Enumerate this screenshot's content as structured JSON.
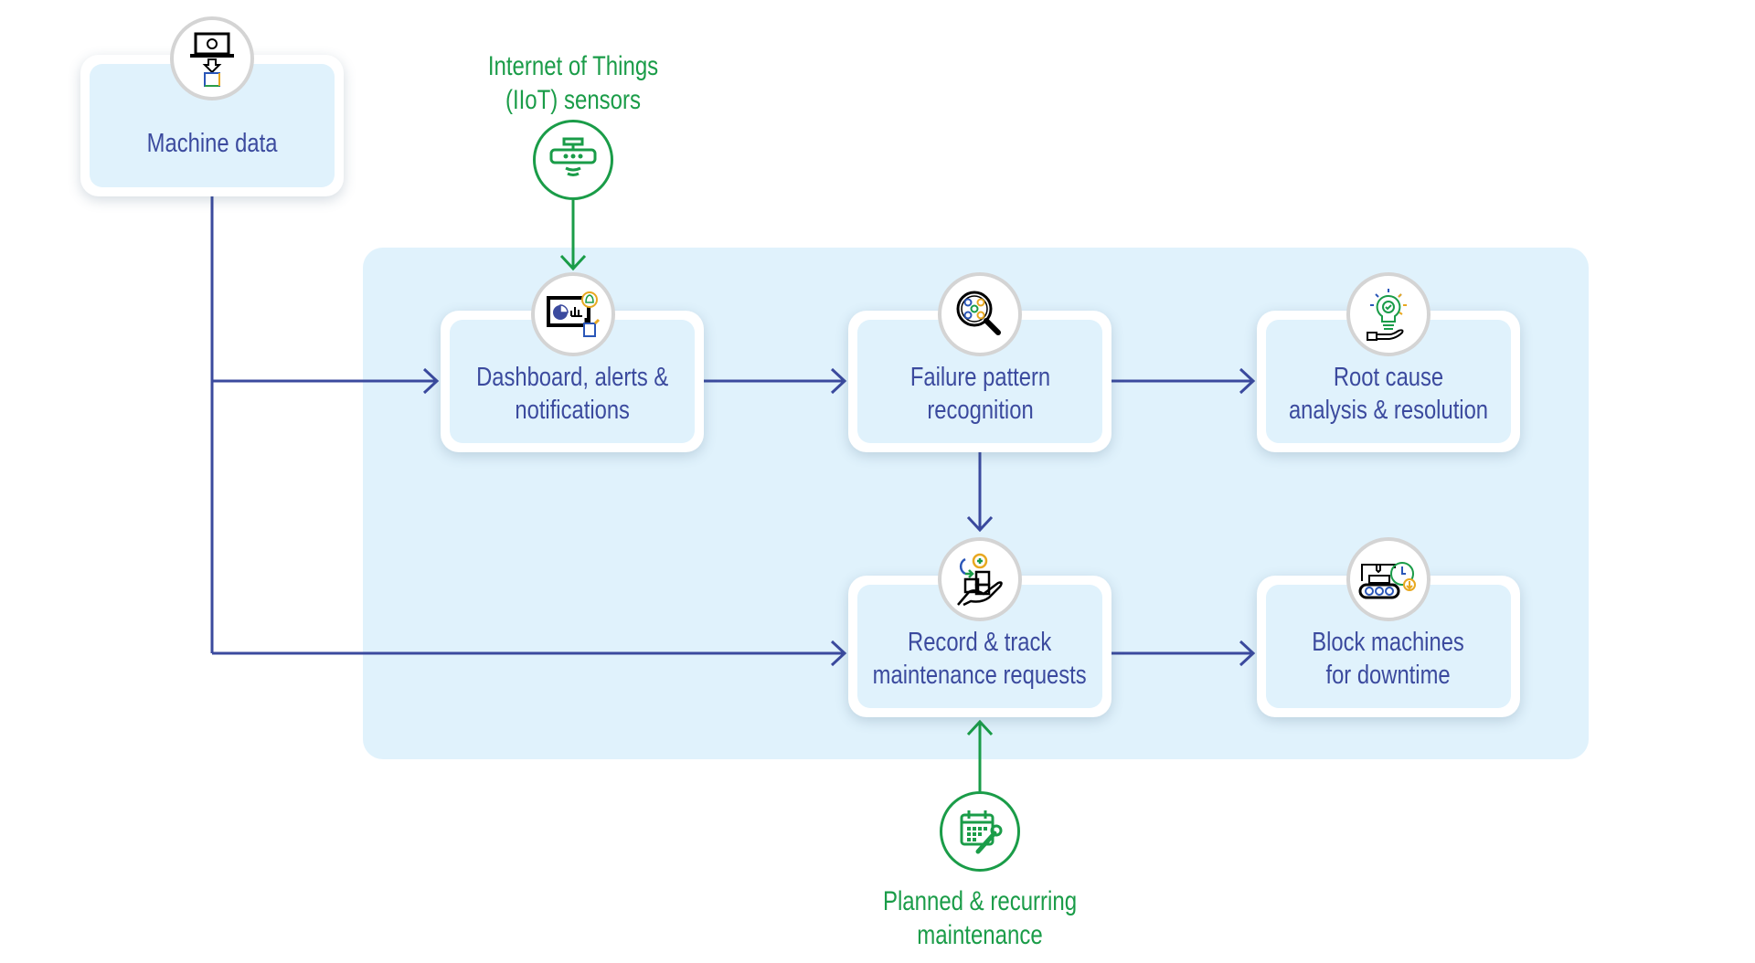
{
  "diagram": {
    "colors": {
      "flow_blue": "#3b4a9e",
      "external_green": "#1a9c48",
      "panel_bg": "#e0f2fc",
      "card_bg": "#ffffff",
      "icon_ring": "#d4d4d4"
    },
    "sources": {
      "machine_data": {
        "label": "Machine data",
        "icon": "laptop-to-spreadsheet-icon"
      },
      "iiot_sensors": {
        "label_line1": "Internet of Things",
        "label_line2": "(IIoT) sensors",
        "icon": "sensor-icon"
      },
      "planned_maintenance": {
        "label_line1": "Planned & recurring",
        "label_line2": "maintenance",
        "icon": "calendar-wrench-icon"
      }
    },
    "steps": [
      {
        "id": "dashboard",
        "label_line1": "Dashboard, alerts &",
        "label_line2": "notifications",
        "icon": "dashboard-alert-icon"
      },
      {
        "id": "failure_pattern",
        "label_line1": "Failure pattern",
        "label_line2": "recognition",
        "icon": "magnifier-pattern-icon"
      },
      {
        "id": "root_cause",
        "label_line1": "Root cause",
        "label_line2": "analysis & resolution",
        "icon": "lightbulb-gear-hand-icon"
      },
      {
        "id": "record_track",
        "label_line1": "Record & track",
        "label_line2": "maintenance requests",
        "icon": "hand-boxes-gear-icon"
      },
      {
        "id": "block_machines",
        "label_line1": "Block machines",
        "label_line2": "for downtime",
        "icon": "machine-clock-icon"
      }
    ],
    "connections": [
      {
        "from": "machine_data",
        "to": "dashboard"
      },
      {
        "from": "machine_data",
        "to": "record_track"
      },
      {
        "from": "iiot_sensors",
        "to": "dashboard"
      },
      {
        "from": "dashboard",
        "to": "failure_pattern"
      },
      {
        "from": "failure_pattern",
        "to": "root_cause"
      },
      {
        "from": "failure_pattern",
        "to": "record_track"
      },
      {
        "from": "record_track",
        "to": "block_machines"
      },
      {
        "from": "planned_maintenance",
        "to": "record_track"
      }
    ]
  }
}
